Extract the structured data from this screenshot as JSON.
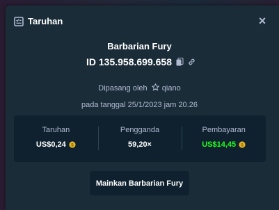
{
  "modal": {
    "title": "Taruhan",
    "close_label": "×",
    "game_name": "Barbarian Fury",
    "bet_id": "ID 135.958.699.658",
    "placed_by_prefix": "Dipasang oleh",
    "placed_by_user": "qiano",
    "placed_date": "pada tanggal 25/1/2023 jam 20.26",
    "stats": [
      {
        "label": "Taruhan",
        "value": "US$0,24"
      },
      {
        "label": "Pengganda",
        "value": "59,20×"
      },
      {
        "label": "Pembayaran",
        "value": "US$14,45"
      }
    ],
    "play_button": "Mainkan Barbarian Fury"
  },
  "icons": {
    "header": "bet-slip-icon",
    "copy": "copy-icon",
    "link": "link-icon",
    "user_badge": "star-icon",
    "currency": "coin-icon"
  },
  "colors": {
    "modal_bg": "#1a2c38",
    "panel_bg": "#0f212e",
    "muted_text": "#b1bad3",
    "payout_green": "#1fff20",
    "coin_gold": "#e5b625"
  }
}
